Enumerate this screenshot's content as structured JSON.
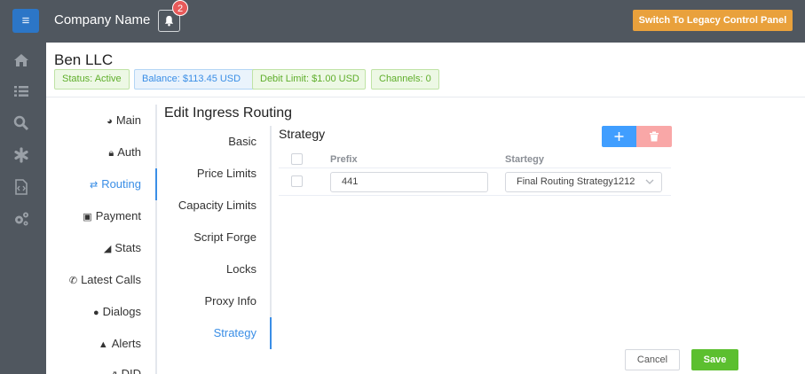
{
  "topbar": {
    "menu_icon": "hamburger-icon",
    "company_name": "Company Name",
    "notification_count": "2",
    "legacy_button": "Switch To Legacy Control Panel"
  },
  "sidebar_icons": [
    "home-icon",
    "list-icon",
    "search-icon",
    "asterisk-icon",
    "code-file-icon",
    "cogs-icon"
  ],
  "customer": {
    "name": "Ben LLC",
    "badges": {
      "status": "Status: Active",
      "balance": "Balance: $113.45 USD",
      "debit_limit": "Debit Limit: $1.00 USD",
      "channels": "Channels: 0"
    }
  },
  "primary_nav": {
    "main": "Main",
    "auth": "Auth",
    "routing": "Routing",
    "payment": "Payment",
    "stats": "Stats",
    "latest_calls": "Latest Calls",
    "dialogs": "Dialogs",
    "alerts": "Alerts",
    "did": "DID",
    "active": "Routing"
  },
  "page_title": "Edit Ingress Routing",
  "secondary_nav": {
    "basic": "Basic",
    "price_limits": "Price Limits",
    "capacity_limits": "Capacity Limits",
    "script_forge": "Script Forge",
    "locks": "Locks",
    "proxy_info": "Proxy Info",
    "strategy": "Strategy",
    "active": "Strategy"
  },
  "strategy": {
    "title": "Strategy",
    "columns": {
      "prefix": "Prefix",
      "strategy": "Startegy"
    },
    "rows": [
      {
        "prefix": "441",
        "strategy": "Final Routing Strategy1212"
      }
    ]
  },
  "footer": {
    "cancel": "Cancel",
    "save": "Save"
  },
  "colors": {
    "accent": "#3a8ee6",
    "topbar": "#50575f",
    "legacy_button": "#e9a13c",
    "save_button": "#5cbf2f",
    "delete_button": "#f9a7a7"
  }
}
